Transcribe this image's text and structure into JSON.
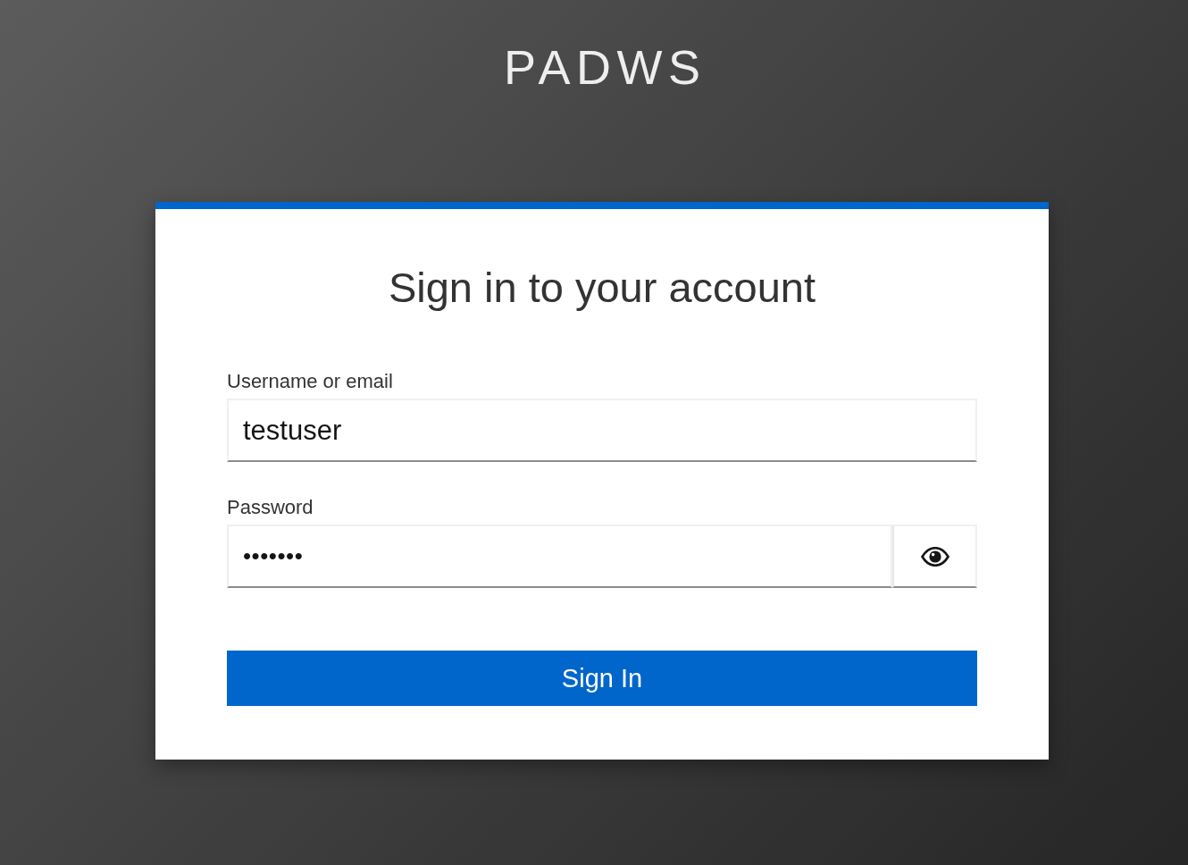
{
  "header": {
    "title": "PADWS"
  },
  "form": {
    "title": "Sign in to your account",
    "fields": [
      {
        "kind": "text",
        "label": "Username or email",
        "value": "testuser"
      },
      {
        "kind": "password",
        "label": "Password",
        "value": "•••••••"
      }
    ],
    "submit": {
      "label": "Sign In"
    }
  }
}
